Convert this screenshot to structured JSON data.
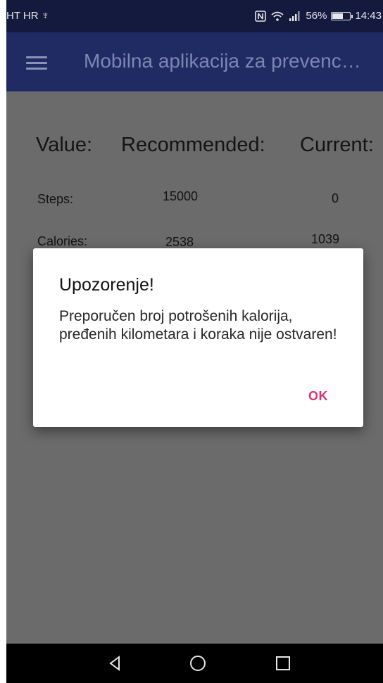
{
  "status_bar": {
    "carrier": "HT HR ♆",
    "battery": "56%",
    "time": "14:43",
    "battery_level": 0.56
  },
  "app_bar": {
    "title": "Mobilna aplikacija za prevenc…"
  },
  "table": {
    "headers": [
      "Value:",
      "Recommended:",
      "Current:"
    ],
    "rows": [
      {
        "label": "Steps:",
        "recommended": "15000",
        "current": "0"
      },
      {
        "label": "Calories:",
        "recommended": "2538",
        "current": "1039"
      }
    ]
  },
  "dialog": {
    "title": "Upozorenje!",
    "message": "Preporučen broj potrošenih kalorija, pređenih kilometara i koraka nije ostvaren!",
    "ok_label": "OK"
  },
  "colors": {
    "status_bar": "#14193e",
    "app_bar": "#202a63",
    "dim_background": "#6b6b6b",
    "dialog_accent": "#e0307a"
  }
}
